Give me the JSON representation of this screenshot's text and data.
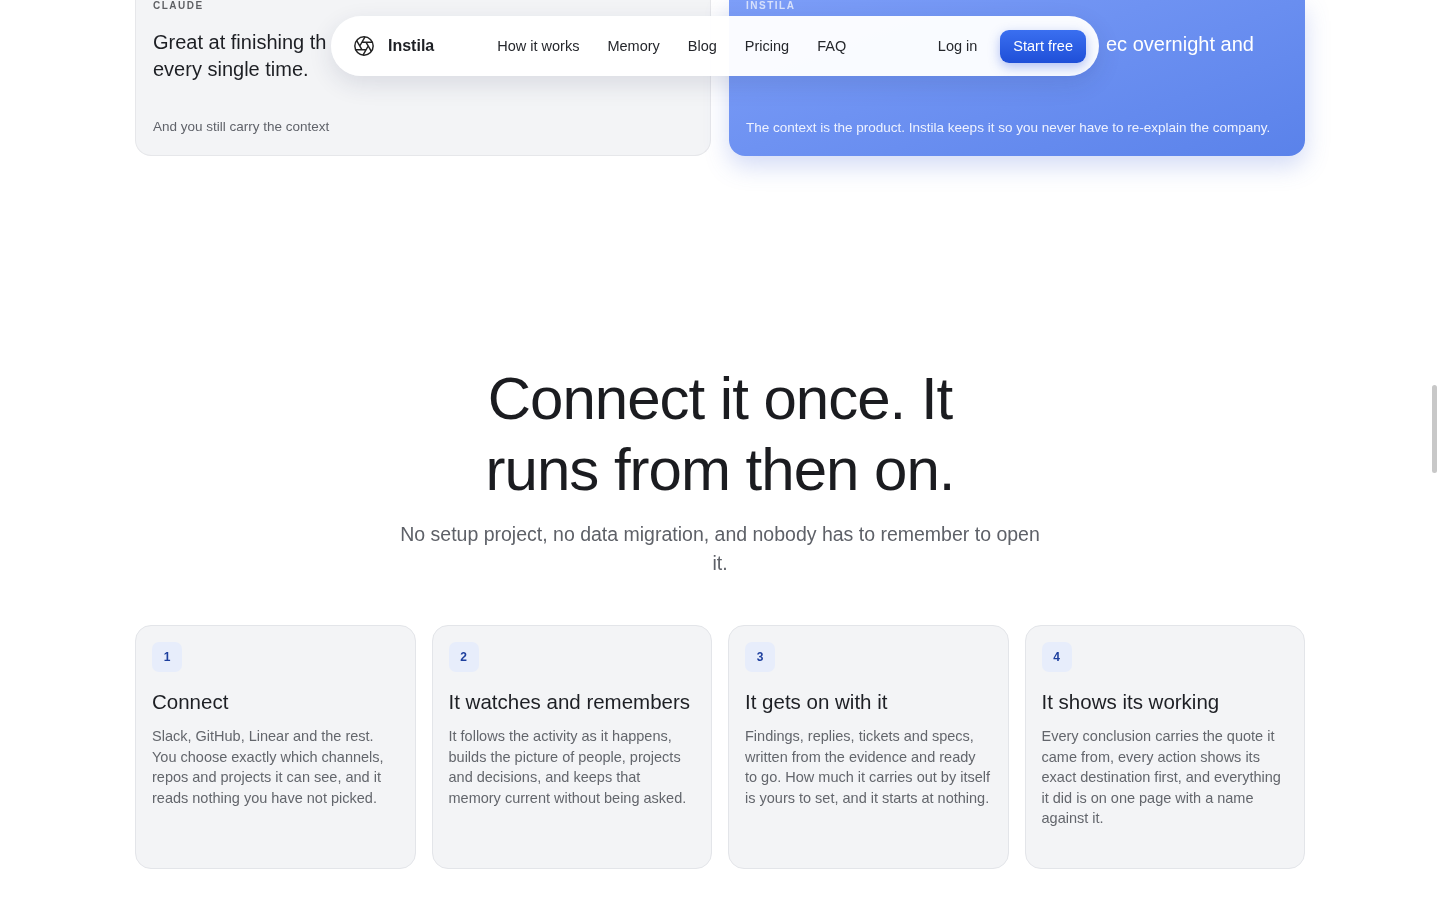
{
  "nav": {
    "brand": "Instila",
    "links": [
      "How it works",
      "Memory",
      "Blog",
      "Pricing",
      "FAQ"
    ],
    "login": "Log in",
    "cta": "Start free"
  },
  "comparison": [
    {
      "kind": "plain",
      "label": "CLAUDE",
      "title": [
        "Great at finishing th",
        "every single time."
      ],
      "note": "And you still carry the context"
    },
    {
      "kind": "accent",
      "label": "INSTILA",
      "title": [
        "ec overnight and"
      ],
      "note": "The context is the product. Instila keeps it so you never have to re-explain the company."
    }
  ],
  "hero": {
    "title": "Connect it once. It runs from then on.",
    "subtitle": "No setup project, no data migration, and nobody has to remember to open it."
  },
  "steps": [
    {
      "number": "1",
      "title": "Connect",
      "body": "Slack, GitHub, Linear and the rest. You choose exactly which channels, repos and projects it can see, and it reads nothing you have not picked."
    },
    {
      "number": "2",
      "title": "It watches and remembers",
      "body": "It follows the activity as it happens, builds the picture of people, projects and decisions, and keeps that memory current without being asked."
    },
    {
      "number": "3",
      "title": "It gets on with it",
      "body": "Findings, replies, tickets and specs, written from the evidence and ready to go. How much it carries out by itself is yours to set, and it starts at nothing."
    },
    {
      "number": "4",
      "title": "It shows its working",
      "body": "Every conclusion carries the quote it came from, every action shows its exact destination first, and everything it did is on one page with a name against it."
    }
  ]
}
